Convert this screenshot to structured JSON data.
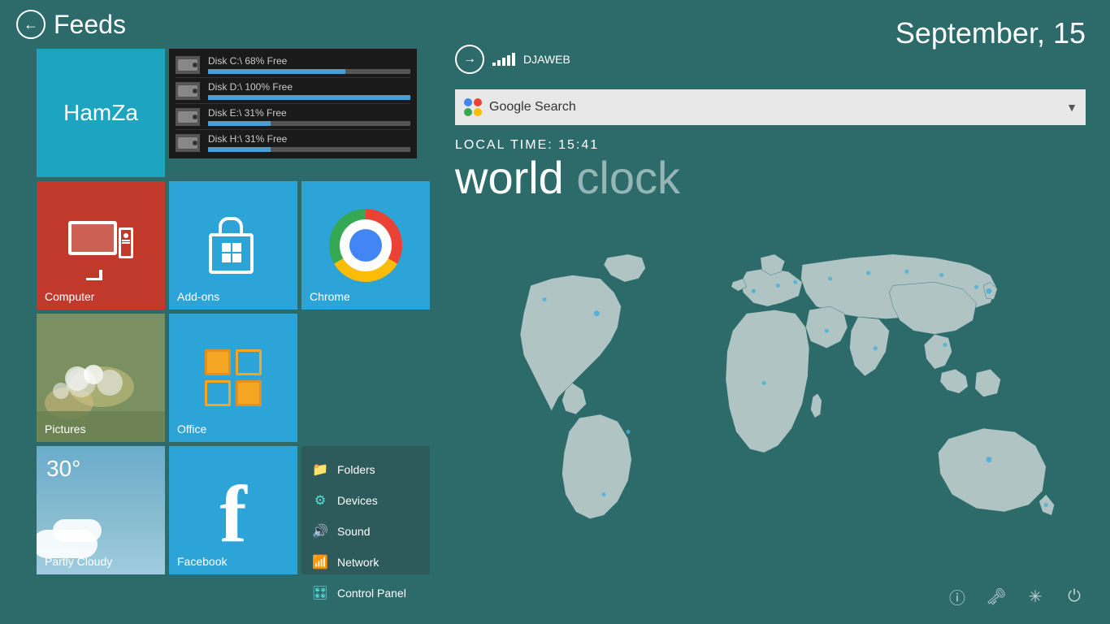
{
  "header": {
    "feeds_label": "Feeds",
    "date": "September, 15"
  },
  "network": {
    "arrow_symbol": "→",
    "name": "DJAWEB"
  },
  "search": {
    "placeholder": "Google Search",
    "value": "Google Search"
  },
  "world_clock": {
    "local_time_label": "LOCAL TIME: 15:41",
    "title_bold": "world",
    "title_light": "clock"
  },
  "disks": [
    {
      "label": "Disk C:\\ 68% Free",
      "fill_percent": 68
    },
    {
      "label": "Disk D:\\ 100% Free",
      "fill_percent": 100
    },
    {
      "label": "Disk E:\\ 31% Free",
      "fill_percent": 31
    },
    {
      "label": "Disk H:\\ 31% Free",
      "fill_percent": 31
    }
  ],
  "tiles": {
    "hamza": {
      "label": "HamZa"
    },
    "computer": {
      "label": "Computer"
    },
    "addons": {
      "label": "Add-ons"
    },
    "chrome": {
      "label": "Chrome"
    },
    "pictures": {
      "label": "Pictures"
    },
    "office": {
      "label": "Office"
    },
    "weather": {
      "temp": "30°",
      "label": "Partly Cloudy"
    },
    "facebook": {
      "label": "Facebook"
    }
  },
  "settings_menu": {
    "items": [
      {
        "icon": "📁",
        "label": "Folders"
      },
      {
        "icon": "⚙",
        "label": "Devices"
      },
      {
        "icon": "🔊",
        "label": "Sound"
      },
      {
        "icon": "📶",
        "label": "Network"
      },
      {
        "icon": "🎛",
        "label": "Control Panel"
      }
    ]
  },
  "bottom_icons": [
    {
      "name": "info-icon",
      "symbol": "ℹ"
    },
    {
      "name": "key-icon",
      "symbol": "🔑"
    },
    {
      "name": "loader-icon",
      "symbol": "✳"
    },
    {
      "name": "power-icon",
      "symbol": "⏻"
    }
  ]
}
